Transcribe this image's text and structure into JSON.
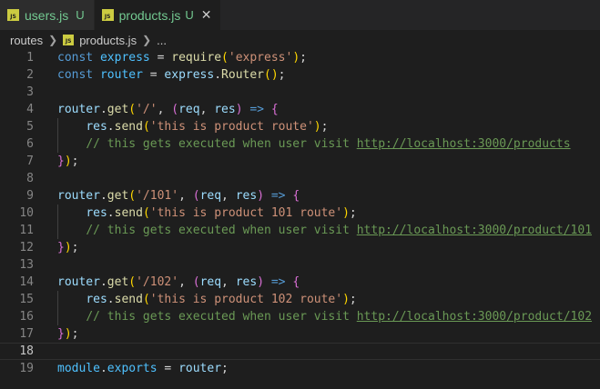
{
  "tabs": [
    {
      "icon": "JS",
      "label": "users.js",
      "status": "U",
      "active": false
    },
    {
      "icon": "JS",
      "label": "products.js",
      "status": "U",
      "active": true,
      "close": "✕"
    }
  ],
  "breadcrumb": {
    "folder": "routes",
    "file_icon": "JS",
    "file": "products.js",
    "symbol": "..."
  },
  "editor": {
    "current_line": 18,
    "lines": [
      {
        "n": "1",
        "tokens": [
          [
            "kw",
            "const "
          ],
          [
            "var",
            "express"
          ],
          [
            "plain",
            " = "
          ],
          [
            "fn",
            "require"
          ],
          [
            "p1",
            "("
          ],
          [
            "str",
            "'express'"
          ],
          [
            "p1",
            ")"
          ],
          [
            "plain",
            ";"
          ]
        ]
      },
      {
        "n": "2",
        "tokens": [
          [
            "kw",
            "const "
          ],
          [
            "var",
            "router"
          ],
          [
            "plain",
            " = "
          ],
          [
            "prop",
            "express"
          ],
          [
            "plain",
            "."
          ],
          [
            "fn",
            "Router"
          ],
          [
            "p1",
            "()"
          ],
          [
            "plain",
            ";"
          ]
        ]
      },
      {
        "n": "3",
        "tokens": []
      },
      {
        "n": "4",
        "tokens": [
          [
            "prop",
            "router"
          ],
          [
            "plain",
            "."
          ],
          [
            "fn",
            "get"
          ],
          [
            "p1",
            "("
          ],
          [
            "str",
            "'/'"
          ],
          [
            "plain",
            ", "
          ],
          [
            "p2",
            "("
          ],
          [
            "prop",
            "req"
          ],
          [
            "plain",
            ", "
          ],
          [
            "prop",
            "res"
          ],
          [
            "p2",
            ")"
          ],
          [
            "plain",
            " "
          ],
          [
            "kw",
            "=>"
          ],
          [
            "plain",
            " "
          ],
          [
            "p2",
            "{"
          ]
        ]
      },
      {
        "n": "5",
        "tokens": [
          [
            "plain",
            "    "
          ],
          [
            "prop",
            "res"
          ],
          [
            "plain",
            "."
          ],
          [
            "fn",
            "send"
          ],
          [
            "p1",
            "("
          ],
          [
            "str",
            "'this is product route'"
          ],
          [
            "p1",
            ")"
          ],
          [
            "plain",
            ";"
          ]
        ]
      },
      {
        "n": "6",
        "tokens": [
          [
            "plain",
            "    "
          ],
          [
            "cm",
            "// this gets executed when user visit "
          ],
          [
            "url",
            "http://localhost:3000/products"
          ]
        ]
      },
      {
        "n": "7",
        "tokens": [
          [
            "p2",
            "}"
          ],
          [
            "p1",
            ")"
          ],
          [
            "plain",
            ";"
          ]
        ]
      },
      {
        "n": "8",
        "tokens": []
      },
      {
        "n": "9",
        "tokens": [
          [
            "prop",
            "router"
          ],
          [
            "plain",
            "."
          ],
          [
            "fn",
            "get"
          ],
          [
            "p1",
            "("
          ],
          [
            "str",
            "'/101'"
          ],
          [
            "plain",
            ", "
          ],
          [
            "p2",
            "("
          ],
          [
            "prop",
            "req"
          ],
          [
            "plain",
            ", "
          ],
          [
            "prop",
            "res"
          ],
          [
            "p2",
            ")"
          ],
          [
            "plain",
            " "
          ],
          [
            "kw",
            "=>"
          ],
          [
            "plain",
            " "
          ],
          [
            "p2",
            "{"
          ]
        ]
      },
      {
        "n": "10",
        "tokens": [
          [
            "plain",
            "    "
          ],
          [
            "prop",
            "res"
          ],
          [
            "plain",
            "."
          ],
          [
            "fn",
            "send"
          ],
          [
            "p1",
            "("
          ],
          [
            "str",
            "'this is product 101 route'"
          ],
          [
            "p1",
            ")"
          ],
          [
            "plain",
            ";"
          ]
        ]
      },
      {
        "n": "11",
        "tokens": [
          [
            "plain",
            "    "
          ],
          [
            "cm",
            "// this gets executed when user visit "
          ],
          [
            "url",
            "http://localhost:3000/product/101"
          ]
        ]
      },
      {
        "n": "12",
        "tokens": [
          [
            "p2",
            "}"
          ],
          [
            "p1",
            ")"
          ],
          [
            "plain",
            ";"
          ]
        ]
      },
      {
        "n": "13",
        "tokens": []
      },
      {
        "n": "14",
        "tokens": [
          [
            "prop",
            "router"
          ],
          [
            "plain",
            "."
          ],
          [
            "fn",
            "get"
          ],
          [
            "p1",
            "("
          ],
          [
            "str",
            "'/102'"
          ],
          [
            "plain",
            ", "
          ],
          [
            "p2",
            "("
          ],
          [
            "prop",
            "req"
          ],
          [
            "plain",
            ", "
          ],
          [
            "prop",
            "res"
          ],
          [
            "p2",
            ")"
          ],
          [
            "plain",
            " "
          ],
          [
            "kw",
            "=>"
          ],
          [
            "plain",
            " "
          ],
          [
            "p2",
            "{"
          ]
        ]
      },
      {
        "n": "15",
        "tokens": [
          [
            "plain",
            "    "
          ],
          [
            "prop",
            "res"
          ],
          [
            "plain",
            "."
          ],
          [
            "fn",
            "send"
          ],
          [
            "p1",
            "("
          ],
          [
            "str",
            "'this is product 102 route'"
          ],
          [
            "p1",
            ")"
          ],
          [
            "plain",
            ";"
          ]
        ]
      },
      {
        "n": "16",
        "tokens": [
          [
            "plain",
            "    "
          ],
          [
            "cm",
            "// this gets executed when user visit "
          ],
          [
            "url",
            "http://localhost:3000/product/102"
          ]
        ]
      },
      {
        "n": "17",
        "tokens": [
          [
            "p2",
            "}"
          ],
          [
            "p1",
            ")"
          ],
          [
            "plain",
            ";"
          ]
        ]
      },
      {
        "n": "18",
        "tokens": []
      },
      {
        "n": "19",
        "tokens": [
          [
            "var",
            "module"
          ],
          [
            "plain",
            "."
          ],
          [
            "var",
            "exports"
          ],
          [
            "plain",
            " = "
          ],
          [
            "prop",
            "router"
          ],
          [
            "plain",
            ";"
          ]
        ]
      }
    ]
  }
}
